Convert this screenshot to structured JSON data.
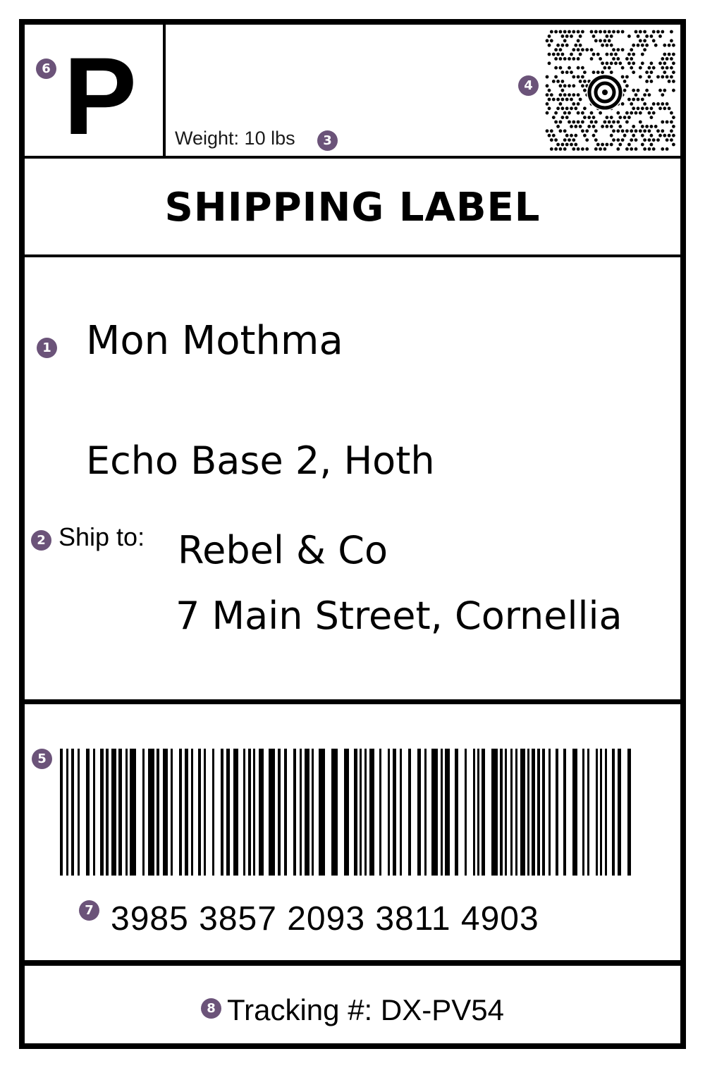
{
  "label": {
    "service_code": "P",
    "weight_text": "Weight: 10 lbs",
    "title": "SHIPPING LABEL",
    "sender": {
      "name": "Mon Mothma",
      "address": "Echo Base 2, Hoth"
    },
    "ship_to_label": "Ship to:",
    "recipient": {
      "name": "Rebel & Co",
      "address": "7 Main Street, Cornellia"
    },
    "barcode_number": "3985 3857 2093 3811 4903",
    "tracking_text": "Tracking #: DX-PV54"
  },
  "callouts": {
    "sender": "1",
    "ship_to": "2",
    "weight": "3",
    "maxicode": "4",
    "barcode": "5",
    "service": "6",
    "barcode_number": "7",
    "tracking": "8"
  },
  "icons": {
    "maxicode": "maxicode-2d-barcode-icon",
    "barcode": "linear-barcode-icon"
  },
  "colors": {
    "callout_badge": "#6b5379",
    "ink": "#000000",
    "paper": "#ffffff"
  }
}
